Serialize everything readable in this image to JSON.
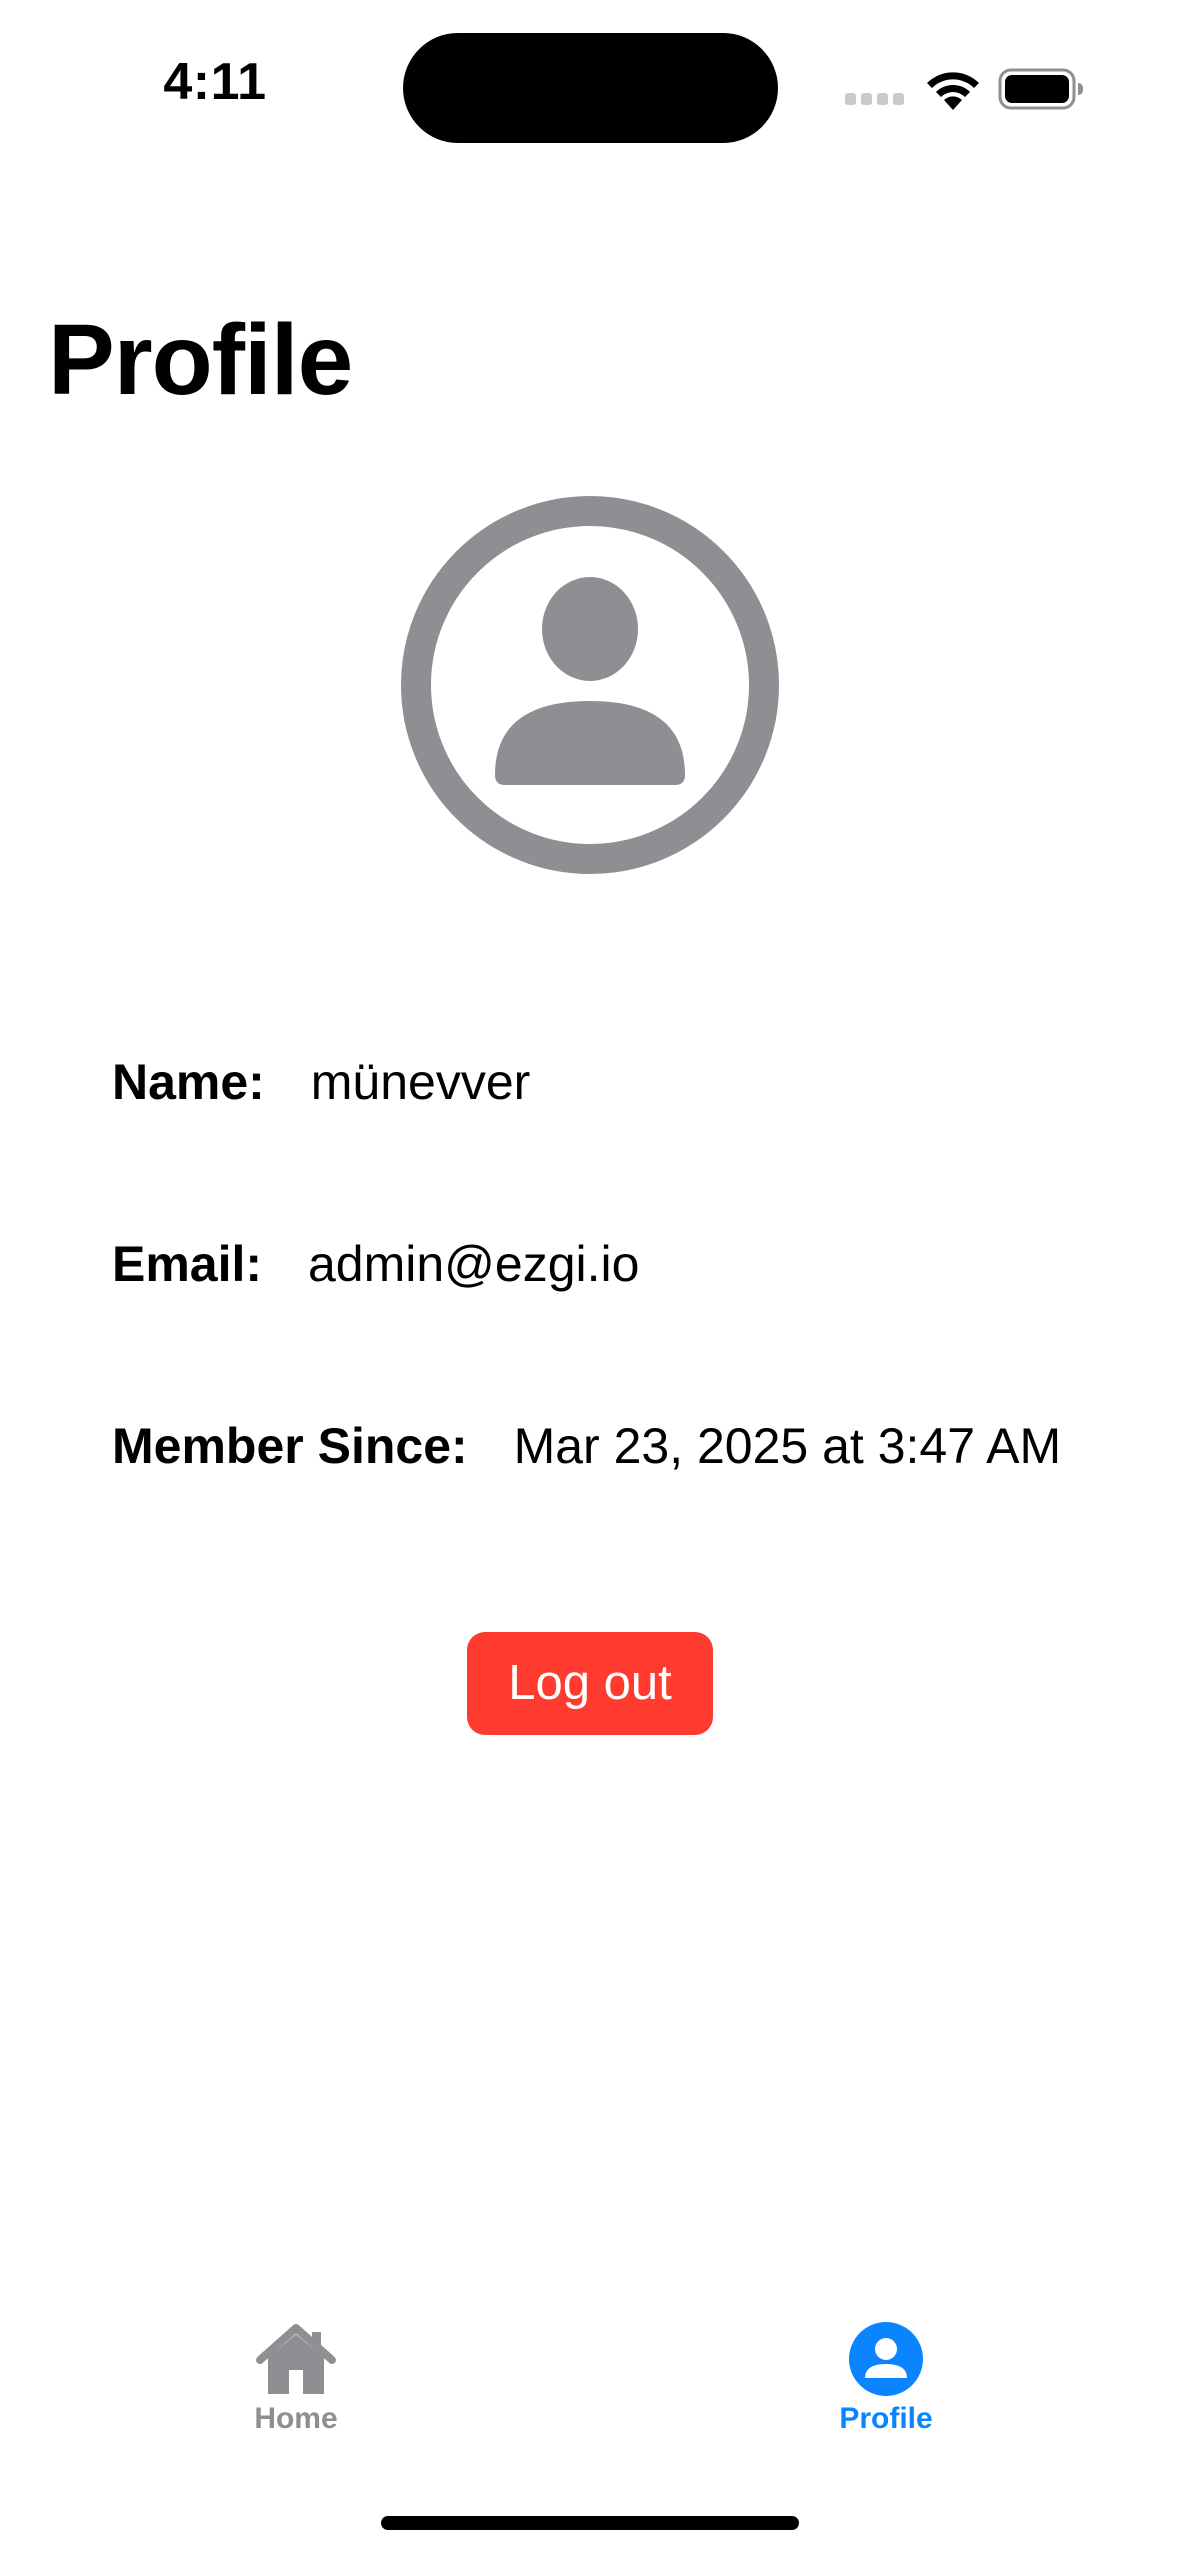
{
  "status_bar": {
    "time": "4:11"
  },
  "page": {
    "title": "Profile"
  },
  "avatar": {
    "icon": "person-circle-icon",
    "color": "#8e8e93"
  },
  "profile": {
    "name_label": "Name:",
    "name_value": "münevver",
    "email_label": "Email:",
    "email_value": "admin@ezgi.io",
    "member_since_label": "Member Since:",
    "member_since_value": "Mar 23, 2025 at 3:47 AM"
  },
  "actions": {
    "logout_label": "Log out",
    "logout_color": "#ff3b30"
  },
  "tab_bar": {
    "items": [
      {
        "label": "Home",
        "icon": "house-icon",
        "selected": false
      },
      {
        "label": "Profile",
        "icon": "person-circle-fill-icon",
        "selected": true
      }
    ],
    "active_color": "#0a84ff",
    "inactive_color": "#8e8e93"
  }
}
